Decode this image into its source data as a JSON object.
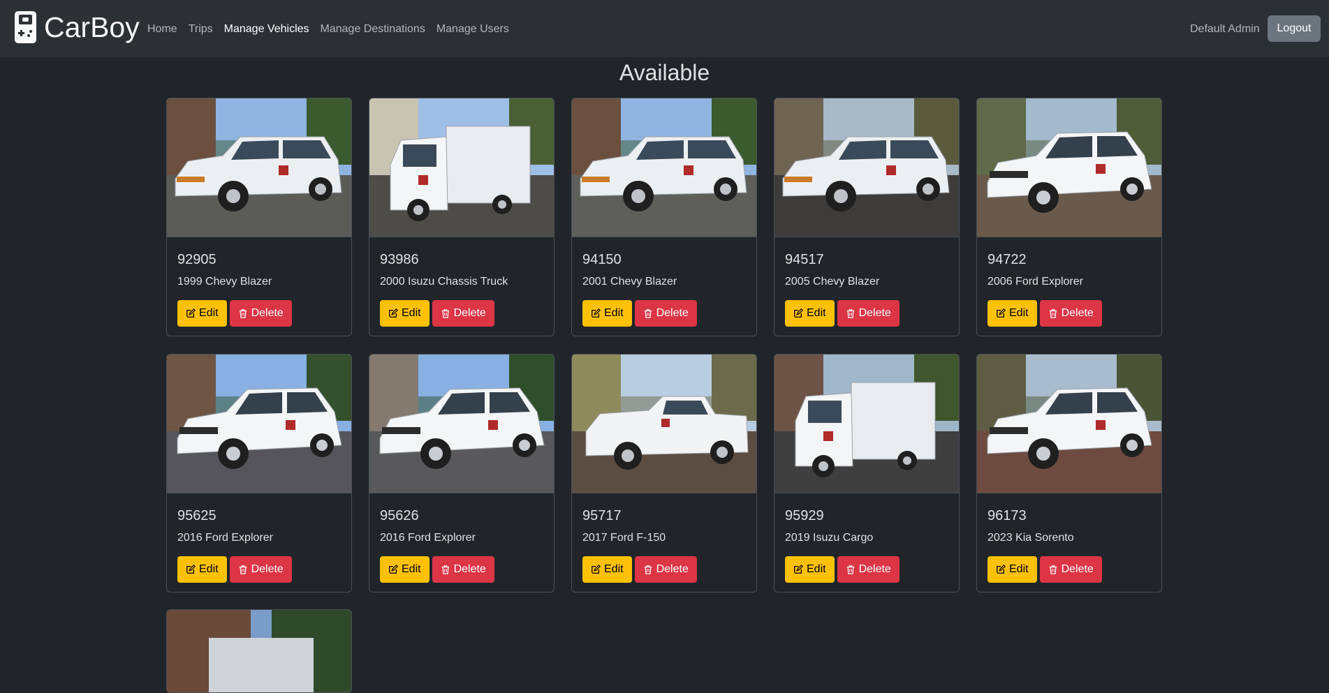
{
  "app": {
    "brand": "CarBoy",
    "user_name": "Default Admin",
    "logout_label": "Logout"
  },
  "nav": {
    "items": [
      {
        "label": "Home",
        "active": false
      },
      {
        "label": "Trips",
        "active": false
      },
      {
        "label": "Manage Vehicles",
        "active": true
      },
      {
        "label": "Manage Destinations",
        "active": false
      },
      {
        "label": "Manage Users",
        "active": false
      }
    ]
  },
  "section": {
    "title": "Available"
  },
  "actions": {
    "edit_label": "Edit",
    "delete_label": "Delete"
  },
  "vehicles": [
    {
      "id": "92905",
      "model": "1999 Chevy Blazer",
      "kind": "suv-old"
    },
    {
      "id": "93986",
      "model": "2000 Isuzu Chassis Truck",
      "kind": "box-truck"
    },
    {
      "id": "94150",
      "model": "2001 Chevy Blazer",
      "kind": "suv-old"
    },
    {
      "id": "94517",
      "model": "2005 Chevy Blazer",
      "kind": "suv-old"
    },
    {
      "id": "94722",
      "model": "2006 Ford Explorer",
      "kind": "suv"
    },
    {
      "id": "95625",
      "model": "2016 Ford Explorer",
      "kind": "suv"
    },
    {
      "id": "95626",
      "model": "2016 Ford Explorer",
      "kind": "suv"
    },
    {
      "id": "95717",
      "model": "2017 Ford F-150",
      "kind": "pickup"
    },
    {
      "id": "95929",
      "model": "2019 Isuzu Cargo",
      "kind": "box-truck"
    },
    {
      "id": "96173",
      "model": "2023 Kia Sorento",
      "kind": "suv"
    }
  ],
  "colors": {
    "edit": "#ffc107",
    "delete": "#dc3545",
    "background": "#212529",
    "navbar": "#2b3035"
  },
  "icons": {
    "edit": "edit-icon",
    "delete": "trash-icon",
    "brand": "gameboy-car-icon"
  }
}
